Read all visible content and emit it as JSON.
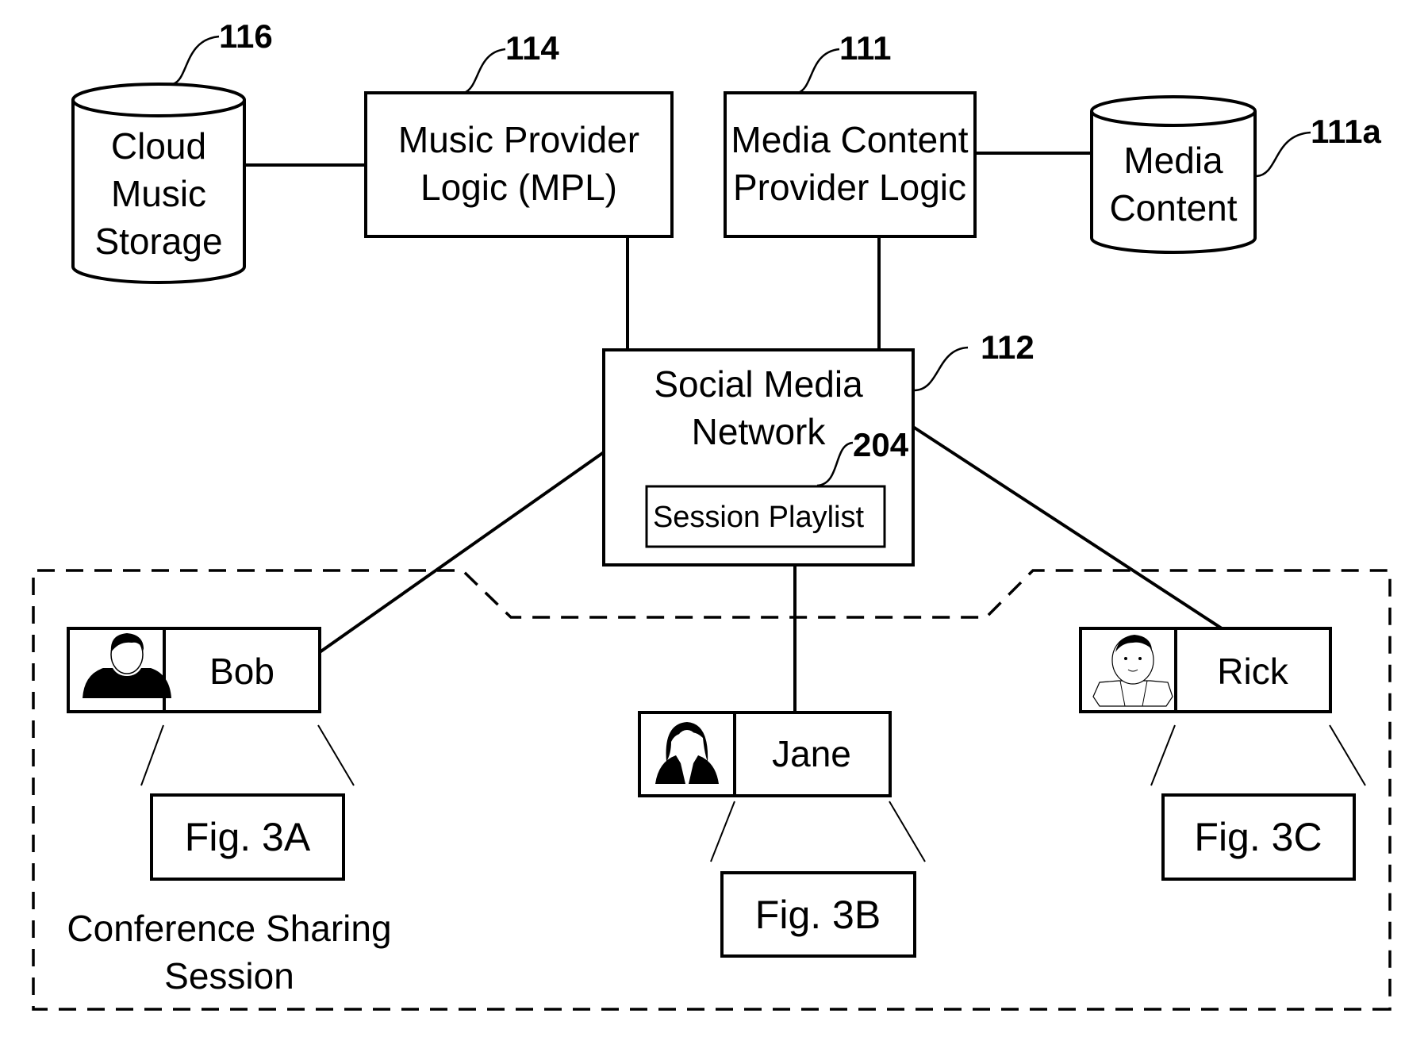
{
  "diagram": {
    "nodes": {
      "cloud_music_storage": {
        "ref": "116",
        "lines": [
          "Cloud",
          "Music",
          "Storage"
        ]
      },
      "music_provider_logic": {
        "ref": "114",
        "lines": [
          "Music Provider",
          "Logic (MPL)"
        ]
      },
      "media_content_provider_logic": {
        "ref": "111",
        "lines": [
          "Media Content",
          "Provider Logic"
        ]
      },
      "media_content": {
        "ref": "111a",
        "lines": [
          "Media",
          "Content"
        ]
      },
      "social_media_network": {
        "ref": "112",
        "lines": [
          "Social Media",
          "Network"
        ]
      },
      "session_playlist": {
        "ref": "204",
        "label": "Session Playlist"
      }
    },
    "users": [
      {
        "name": "Bob",
        "avatar": "male-user-icon",
        "figure": "Fig. 3A"
      },
      {
        "name": "Jane",
        "avatar": "female-user-icon",
        "figure": "Fig. 3B"
      },
      {
        "name": "Rick",
        "avatar": "cartoon-user-icon",
        "figure": "Fig. 3C"
      }
    ],
    "session_region": {
      "lines": [
        "Conference Sharing",
        "Session"
      ]
    },
    "edges": [
      [
        "cloud_music_storage",
        "music_provider_logic"
      ],
      [
        "media_content_provider_logic",
        "media_content"
      ],
      [
        "music_provider_logic",
        "social_media_network"
      ],
      [
        "media_content_provider_logic",
        "social_media_network"
      ],
      [
        "social_media_network",
        "Bob"
      ],
      [
        "social_media_network",
        "Jane"
      ],
      [
        "social_media_network",
        "Rick"
      ]
    ]
  }
}
